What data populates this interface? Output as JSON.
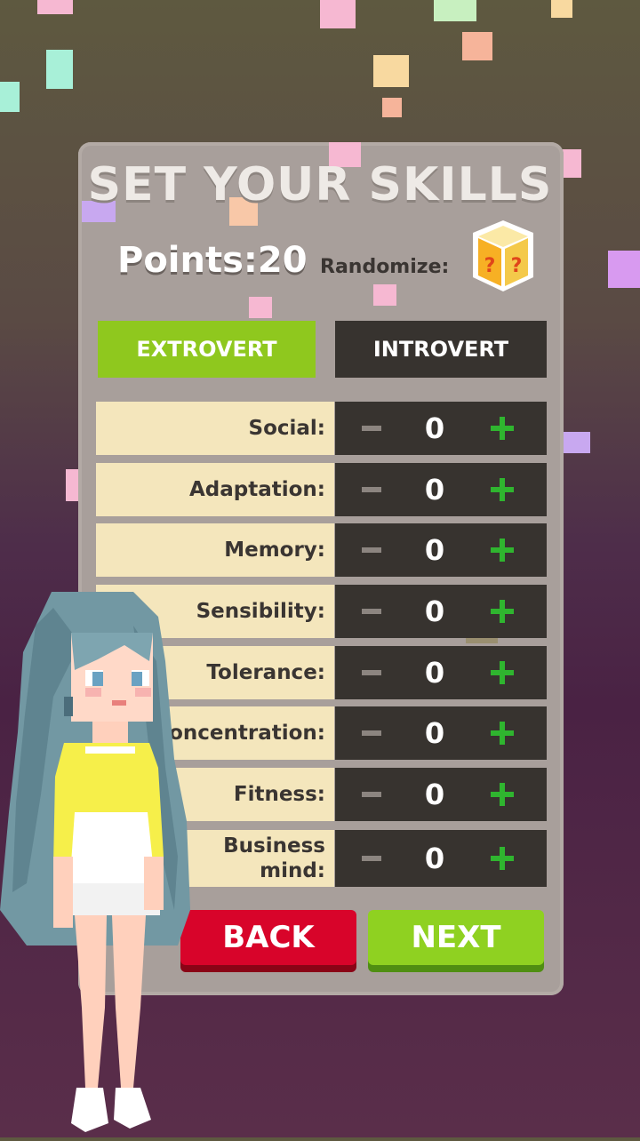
{
  "title": "SET YOUR SKILLS",
  "points_label": "Points:20",
  "randomize_label": "Randomize:",
  "dice_symbol": "?",
  "mode": {
    "extrovert": "EXTROVERT",
    "introvert": "INTROVERT",
    "selected": "EXTROVERT"
  },
  "skills": [
    {
      "label": "Social:",
      "value": "0"
    },
    {
      "label": "Adaptation:",
      "value": "0"
    },
    {
      "label": "Memory:",
      "value": "0"
    },
    {
      "label": "Sensibility:",
      "value": "0"
    },
    {
      "label": "Tolerance:",
      "value": "0"
    },
    {
      "label": "Concentration:",
      "value": "0"
    },
    {
      "label": "Fitness:",
      "value": "0"
    },
    {
      "label": "Business mind:",
      "value": "0"
    }
  ],
  "buttons": {
    "back": "BACK",
    "next": "NEXT"
  },
  "colors": {
    "extrovert_green": "#8fc81e",
    "dark_panel": "#37332f",
    "label_cream": "#f4e6bc",
    "back_red": "#d8042a",
    "next_green": "#8fd121",
    "plus_green": "#2fb52f"
  }
}
